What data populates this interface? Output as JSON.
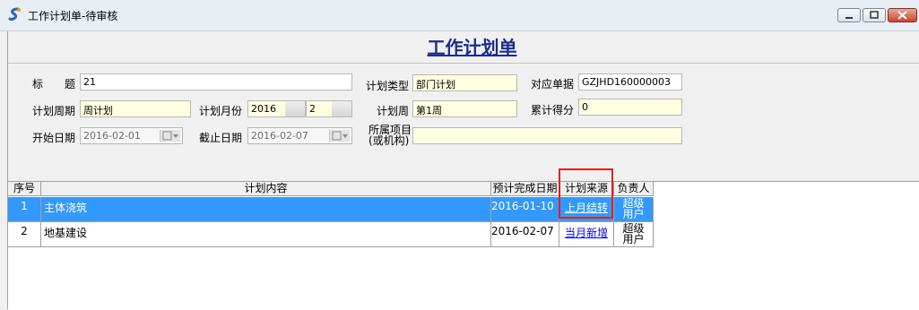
{
  "window": {
    "title": "工作计划单-待审核"
  },
  "form": {
    "title": "工作计划单",
    "fields": {
      "title_label_1": "标",
      "title_label_2": "题",
      "title_value": "21",
      "plan_type_label": "计划类型",
      "plan_type_value": "部门计划",
      "ref_doc_label": "对应单据",
      "ref_doc_value": "GZJHD160000003",
      "period_label": "计划周期",
      "period_value": "周计划",
      "month_label": "计划月份",
      "year_value": "2016",
      "month_value": "2",
      "week_label": "计划周",
      "week_value": "第1周",
      "score_label": "累计得分",
      "score_value": "0",
      "start_label": "开始日期",
      "start_value": "2016-02-01",
      "end_label": "截止日期",
      "end_value": "2016-02-07",
      "project_label_1": "所属项目",
      "project_label_2": "(或机构)",
      "project_value": ""
    }
  },
  "table": {
    "headers": [
      "序号",
      "计划内容",
      "预计完成日期",
      "计划来源",
      "负责人"
    ],
    "rows": [
      {
        "index": "1",
        "content": "主体浇筑",
        "due": "2016-01-10",
        "source": "上月结转",
        "owner": "超级用户"
      },
      {
        "index": "2",
        "content": "地基建设",
        "due": "2016-02-07",
        "source": "当月新增",
        "owner": "超级用户"
      }
    ]
  },
  "icons": {
    "app": "app-logo-icon",
    "calendar": "calendar-icon"
  },
  "colors": {
    "title": "#1c2b8c",
    "selection": "#3399ff",
    "highlight_box": "#e02020",
    "input_yellow": "#ffffe1"
  }
}
